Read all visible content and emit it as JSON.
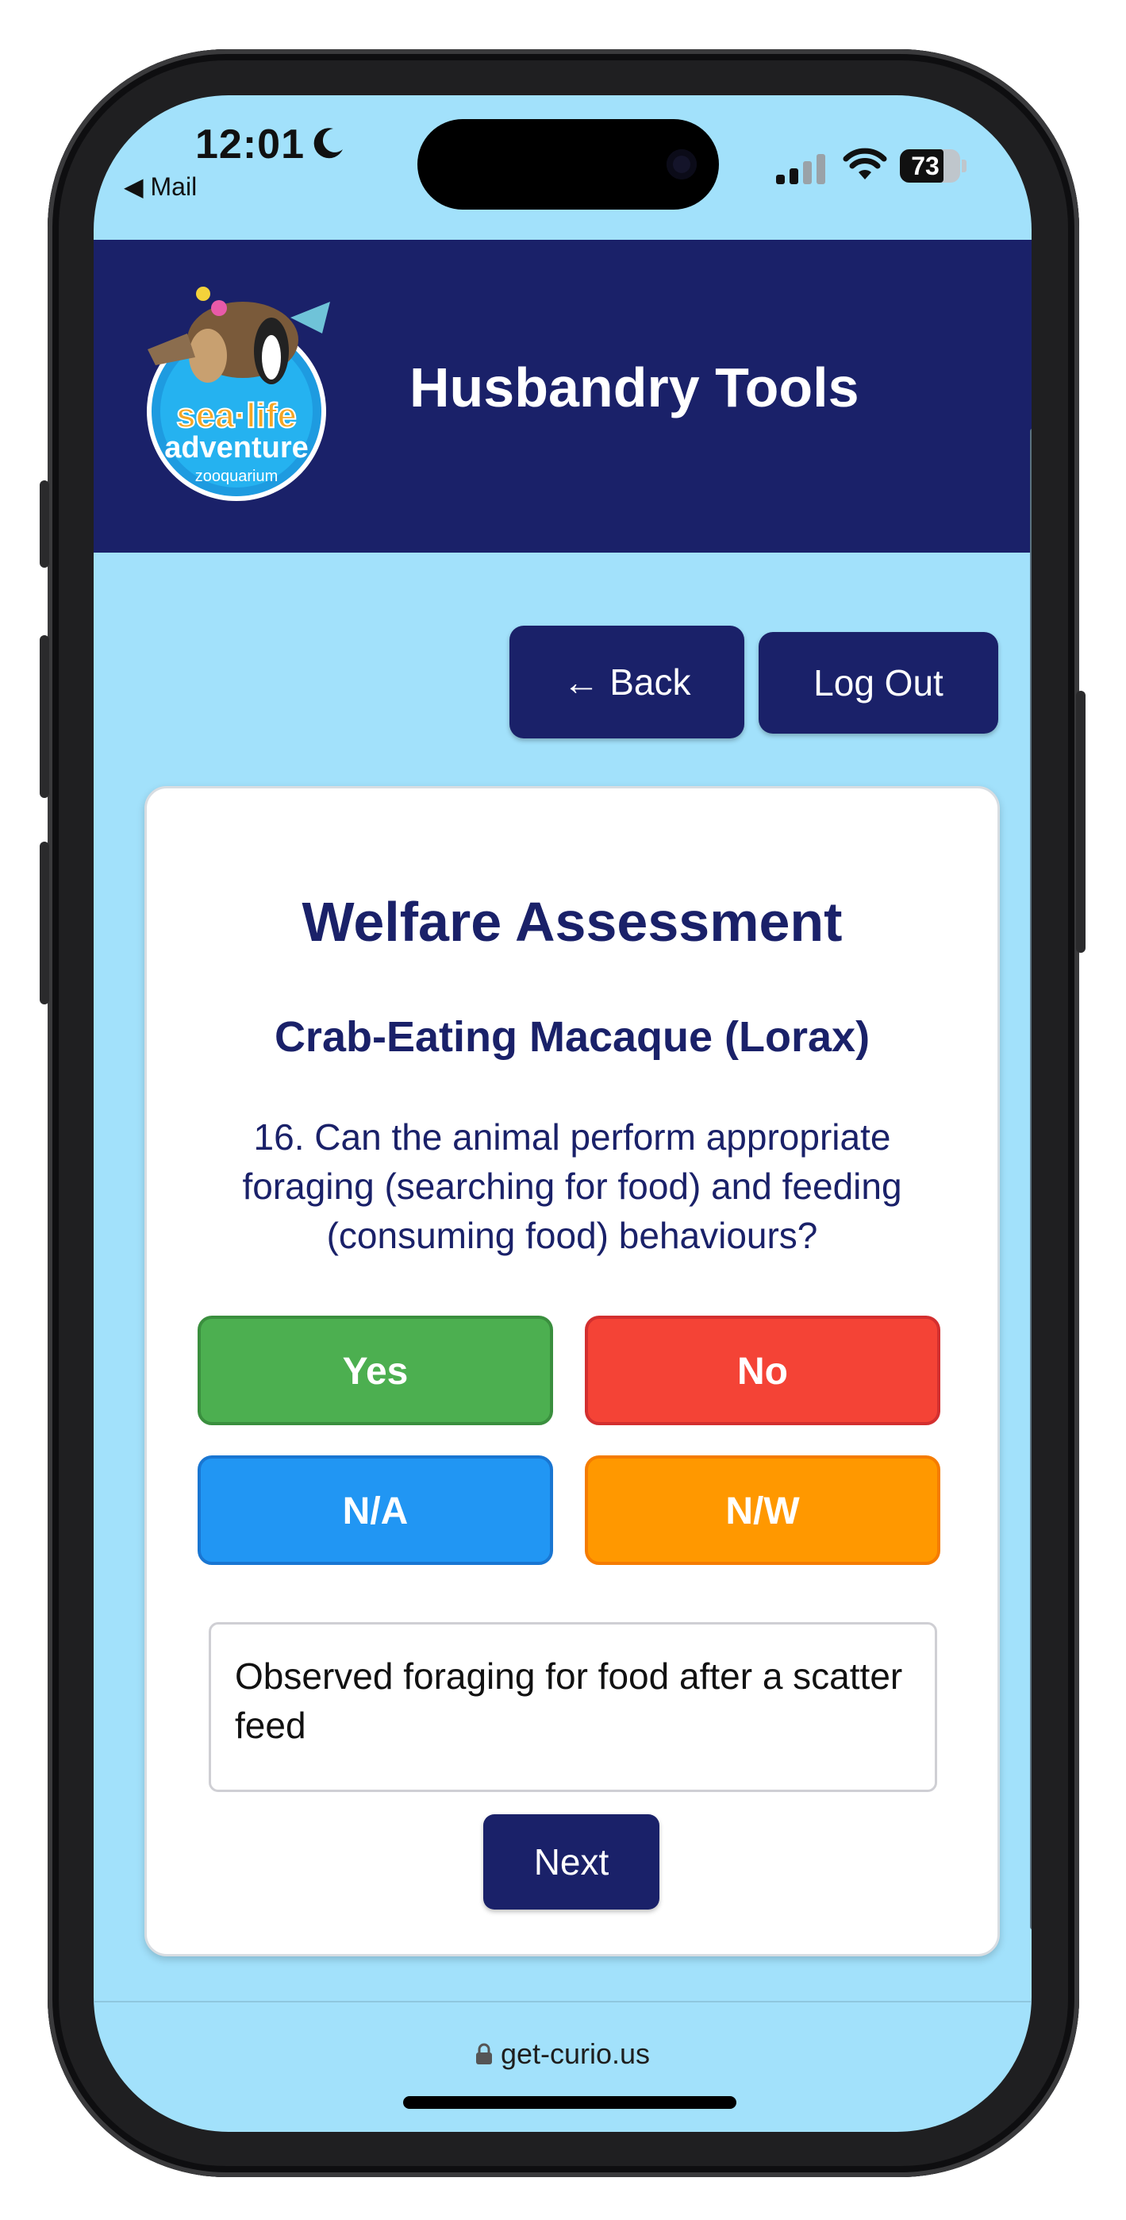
{
  "status_bar": {
    "time": "12:01",
    "back_app": "◀ Mail",
    "battery": "73",
    "battery_level": 0.73
  },
  "header": {
    "title": "Husbandry Tools",
    "logo_text": [
      "sea-life",
      "adventure",
      "zooquarium"
    ]
  },
  "nav": {
    "back_label": "← Back",
    "logout_label": "Log Out"
  },
  "card": {
    "title": "Welfare Assessment",
    "animal": "Crab-Eating Macaque (Lorax)",
    "question": "16. Can the animal perform appropriate foraging (searching for food) and feeding (consuming food) behaviours?",
    "answers": {
      "yes": "Yes",
      "no": "No",
      "na": "N/A",
      "nw": "N/W"
    },
    "comment_value": "Observed foraging for food after a scatter feed",
    "next_label": "Next"
  },
  "url_bar": {
    "url": "get-curio.us"
  },
  "colors": {
    "navy": "#1a2169",
    "background": "#a2e1fb",
    "yes": "#4caf50",
    "no": "#f44336",
    "na": "#2196f3",
    "nw": "#ff9800"
  }
}
